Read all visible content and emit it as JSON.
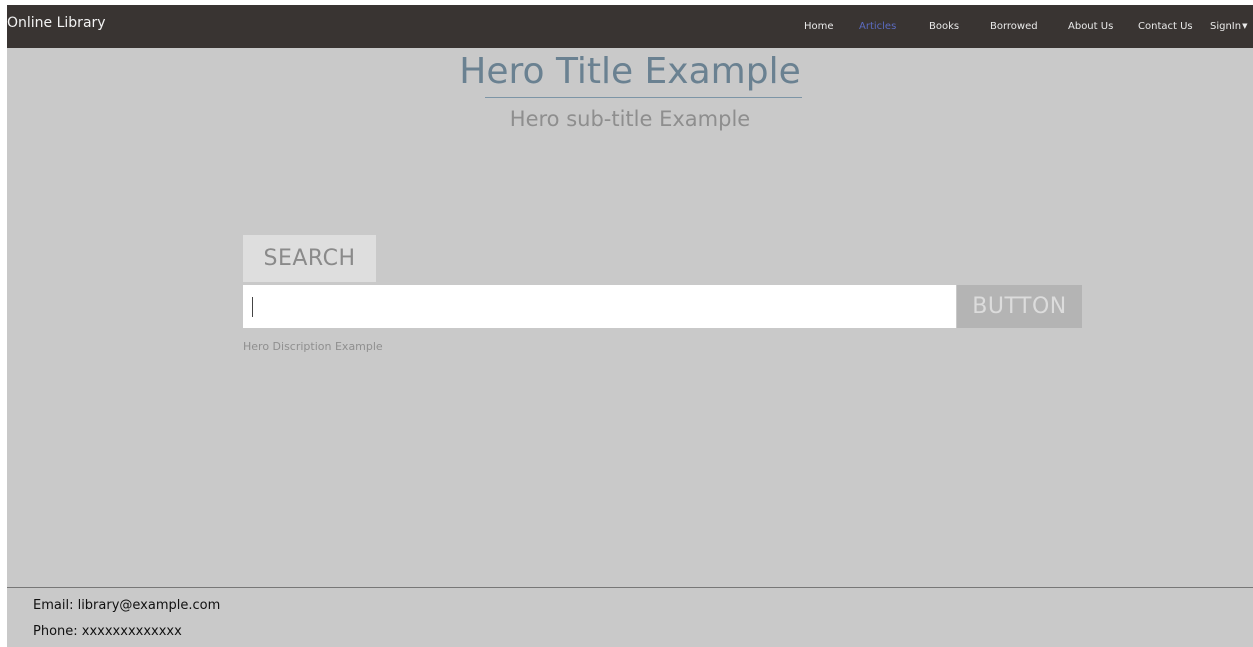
{
  "navbar": {
    "brand": "Online Library",
    "items": [
      {
        "label": "Home",
        "active": false
      },
      {
        "label": "Articles",
        "active": true
      },
      {
        "label": "Books",
        "active": false
      },
      {
        "label": "Borrowed",
        "active": false
      },
      {
        "label": "About Us",
        "active": false
      },
      {
        "label": "Contact Us",
        "active": false
      },
      {
        "label": "SignIn",
        "active": false,
        "icon": "chevron-down-icon"
      }
    ],
    "active_color": "#5b6bc0"
  },
  "hero": {
    "title": "Hero Title Example",
    "subtitle": "Hero sub-title Example",
    "description": "Hero Discription Example"
  },
  "search": {
    "tab_label": "SEARCH",
    "input_value": "",
    "button_label": "BUTTON"
  },
  "footer": {
    "email_line": "Email: library@example.com",
    "phone_line": "Phone: xxxxxxxxxxxxx"
  }
}
